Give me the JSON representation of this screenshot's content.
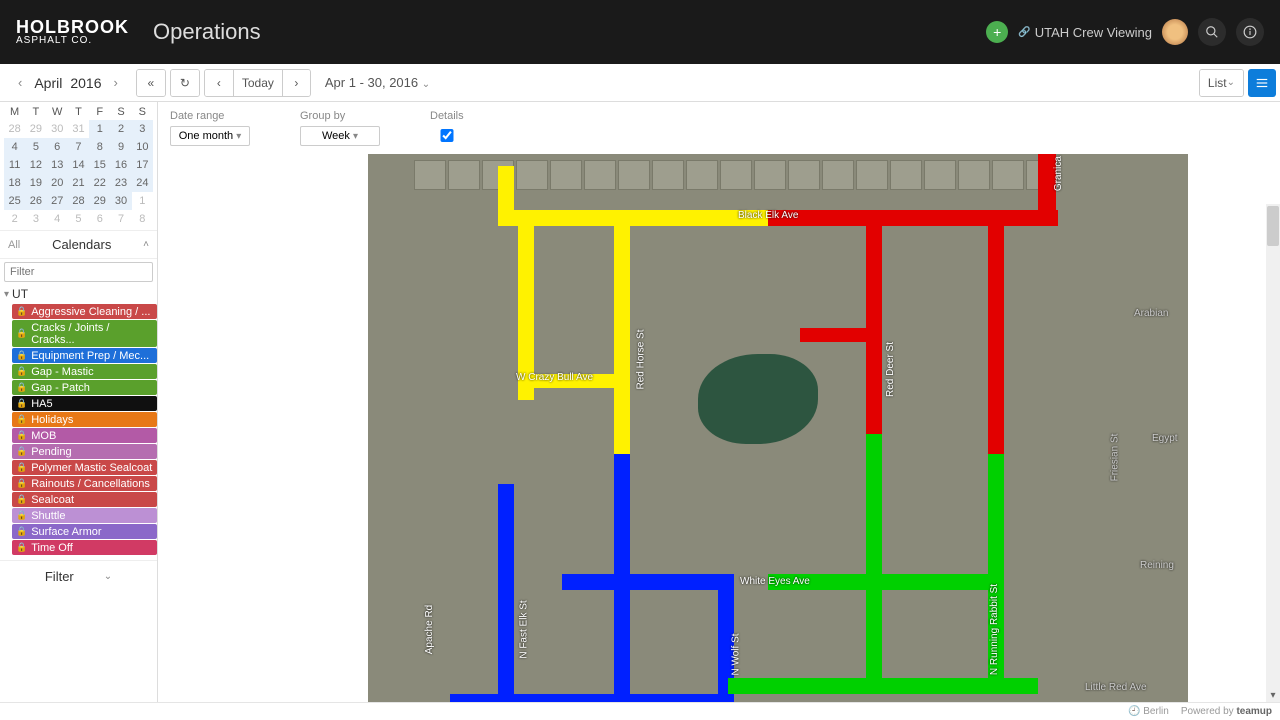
{
  "header": {
    "logo_top": "HOLBROOK",
    "logo_bot": "ASPHALT CO.",
    "title": "Operations",
    "user_text": "UTAH Crew Viewing"
  },
  "toolbar": {
    "month": "April",
    "year": "2016",
    "today": "Today",
    "range": "Apr 1 - 30, 2016",
    "list": "List"
  },
  "minical": {
    "dow": [
      "M",
      "T",
      "W",
      "T",
      "F",
      "S",
      "S"
    ],
    "rows": [
      [
        {
          "n": "28",
          "o": 1
        },
        {
          "n": "29",
          "o": 1
        },
        {
          "n": "30",
          "o": 1
        },
        {
          "n": "31",
          "o": 1
        },
        {
          "n": "1",
          "s": 1
        },
        {
          "n": "2",
          "s": 1
        },
        {
          "n": "3",
          "s": 1
        }
      ],
      [
        {
          "n": "4",
          "s": 1
        },
        {
          "n": "5",
          "s": 1
        },
        {
          "n": "6",
          "s": 1
        },
        {
          "n": "7",
          "s": 1
        },
        {
          "n": "8",
          "s": 1
        },
        {
          "n": "9",
          "s": 1
        },
        {
          "n": "10",
          "s": 1
        }
      ],
      [
        {
          "n": "11",
          "s": 1
        },
        {
          "n": "12",
          "s": 1
        },
        {
          "n": "13",
          "s": 1
        },
        {
          "n": "14",
          "s": 1
        },
        {
          "n": "15",
          "s": 1
        },
        {
          "n": "16",
          "s": 1
        },
        {
          "n": "17",
          "s": 1
        }
      ],
      [
        {
          "n": "18",
          "s": 1
        },
        {
          "n": "19",
          "s": 1
        },
        {
          "n": "20",
          "s": 1
        },
        {
          "n": "21",
          "s": 1
        },
        {
          "n": "22",
          "s": 1
        },
        {
          "n": "23",
          "s": 1
        },
        {
          "n": "24",
          "s": 1
        }
      ],
      [
        {
          "n": "25",
          "s": 1
        },
        {
          "n": "26",
          "s": 1
        },
        {
          "n": "27",
          "s": 1
        },
        {
          "n": "28",
          "s": 1
        },
        {
          "n": "29",
          "s": 1
        },
        {
          "n": "30",
          "s": 1
        },
        {
          "n": "1",
          "o": 1
        }
      ],
      [
        {
          "n": "2",
          "o": 1
        },
        {
          "n": "3",
          "o": 1
        },
        {
          "n": "4",
          "o": 1
        },
        {
          "n": "5",
          "o": 1
        },
        {
          "n": "6",
          "o": 1
        },
        {
          "n": "7",
          "o": 1
        },
        {
          "n": "8",
          "o": 1
        }
      ]
    ]
  },
  "calendars": {
    "all": "All",
    "title": "Calendars",
    "filter_ph": "Filter",
    "root": "UT",
    "items": [
      {
        "label": "Aggressive Cleaning / ...",
        "color": "#c94848"
      },
      {
        "label": "Cracks / Joints / Cracks...",
        "color": "#5aa02c"
      },
      {
        "label": "Equipment Prep / Mec...",
        "color": "#1e6fd9"
      },
      {
        "label": "Gap - Mastic",
        "color": "#5aa02c"
      },
      {
        "label": "Gap - Patch",
        "color": "#5aa02c"
      },
      {
        "label": "HA5",
        "color": "#101010"
      },
      {
        "label": "Holidays",
        "color": "#e77817"
      },
      {
        "label": "MOB",
        "color": "#b35aa6"
      },
      {
        "label": "Pending",
        "color": "#b56db0"
      },
      {
        "label": "Polymer Mastic Sealcoat",
        "color": "#c94848"
      },
      {
        "label": "Rainouts / Cancellations",
        "color": "#c94848"
      },
      {
        "label": "Sealcoat",
        "color": "#c94848"
      },
      {
        "label": "Shuttle",
        "color": "#bc90d4"
      },
      {
        "label": "Surface Armor",
        "color": "#8b68c9"
      },
      {
        "label": "Time Off",
        "color": "#d13a64"
      }
    ],
    "filter_label": "Filter"
  },
  "controls": {
    "date_range_lbl": "Date range",
    "date_range_val": "One month",
    "group_by_lbl": "Group by",
    "group_by_val": "Week",
    "details_lbl": "Details",
    "details_checked": true
  },
  "map": {
    "streets": {
      "black_elk": "Black Elk Ave",
      "crazy_bull": "W Crazy Bull Ave",
      "red_horse": "Red Horse St",
      "red_deer": "Red Deer St",
      "white_eyes": "White Eyes Ave",
      "fast_elk": "N Fast Elk St",
      "wolf": "N Wolf St",
      "running_rabbit": "N Running Rabbit St",
      "apache": "Apache Rd",
      "granica": "Granica St",
      "arabian": "Arabian",
      "egypt": "Egypt",
      "friesian": "Friesian St",
      "reining": "Reining",
      "little_red": "Little Red Ave"
    }
  },
  "footer": {
    "tz": "Berlin",
    "powered": "Powered by",
    "brand": "teamup"
  }
}
